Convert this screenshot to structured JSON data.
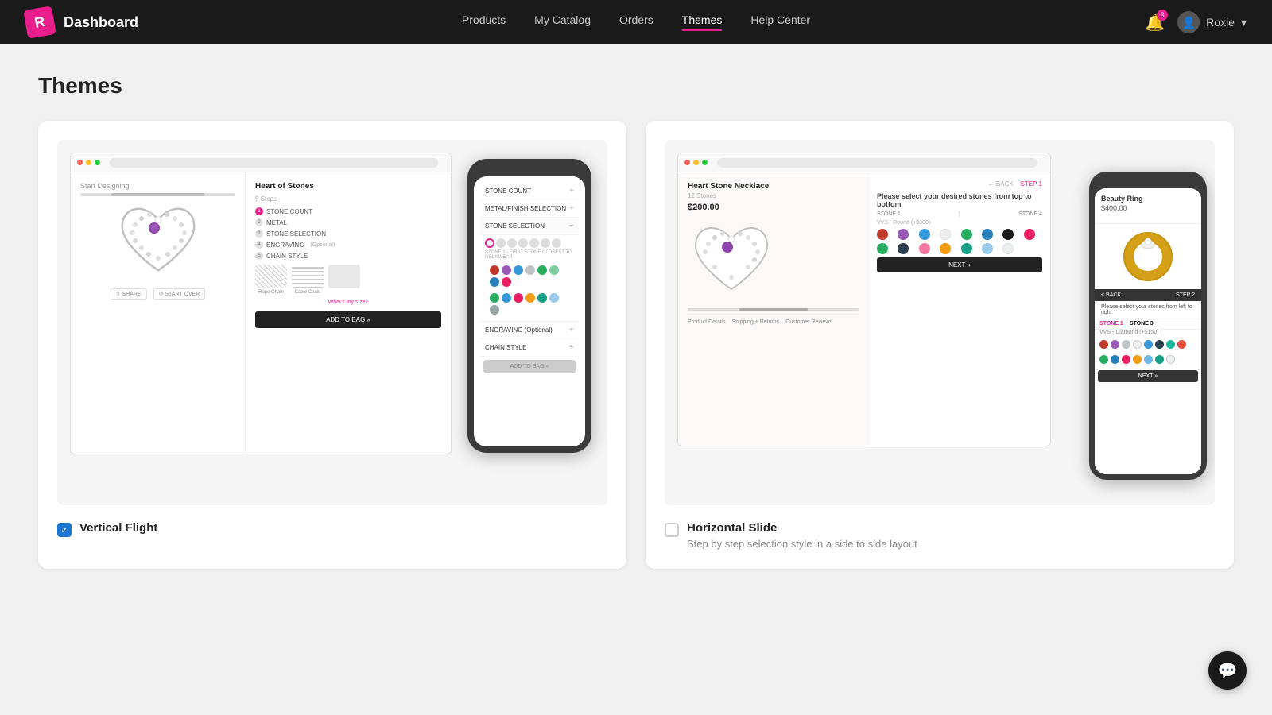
{
  "brand": {
    "logo_text": "R",
    "name": "Dashboard"
  },
  "nav": {
    "links": [
      {
        "label": "Products",
        "active": false
      },
      {
        "label": "My Catalog",
        "active": false
      },
      {
        "label": "Orders",
        "active": false
      },
      {
        "label": "Themes",
        "active": true
      },
      {
        "label": "Help Center",
        "active": false
      }
    ],
    "notification_count": "3",
    "user_name": "Roxie"
  },
  "page": {
    "title": "Themes"
  },
  "theme_left": {
    "product_title": "Heart of Stones",
    "steps": [
      {
        "num": "1",
        "label": "STONE COUNT",
        "active": true
      },
      {
        "num": "2",
        "label": "METAL",
        "active": false
      },
      {
        "num": "3",
        "label": "STONE SELECTION",
        "active": false
      },
      {
        "num": "4",
        "label": "ENGRAVING",
        "active": false
      },
      {
        "num": "5",
        "label": "CHAIN STYLE",
        "active": false
      }
    ],
    "chain_styles": [
      "Rope Chain",
      "Cable Chain"
    ],
    "add_to_bag": "ADD TO BAG »",
    "mobile": {
      "steps": [
        {
          "label": "STONE COUNT",
          "open": false
        },
        {
          "label": "METAL/FINISH SELECTION",
          "open": false
        },
        {
          "label": "STONE SELECTION",
          "open": true
        },
        {
          "label": "ENGRAVING (Optional)",
          "open": false
        },
        {
          "label": "CHAIN STYLE",
          "open": false
        }
      ],
      "add_to_bag": "ADD TO BAG »"
    },
    "checkbox_label": "Vertical Flight",
    "checked": true
  },
  "theme_right": {
    "product_title": "Heart Stone Necklace",
    "stone_count": "12 Stones",
    "price": "$200.00",
    "step_label": "STEP 1",
    "step_desc": "Please select your desired stones from top to bottom",
    "stone_nav": [
      "STONE 1",
      "STONE 4"
    ],
    "next_btn": "NEXT »",
    "detail_tabs": [
      "Product Details",
      "Shipping + Returns",
      "Customer Reviews"
    ],
    "mobile": {
      "title": "Beauty Ring",
      "price": "$400.00",
      "step_label": "STEP 2",
      "step_desc": "Please select your stones from left to right",
      "stone_labels": [
        "STONE 1",
        "STONE 3"
      ],
      "stone_price": "VVS - Diamond (+$150)",
      "next_btn": "NEXT »",
      "back_label": "< BACK"
    },
    "checkbox_label": "Horizontal Slide",
    "checked": false,
    "checkbox_desc": "Step by step selection style in a side to side layout"
  },
  "chat": {
    "icon": "💬"
  },
  "stones_colors_left": [
    "#c0392b",
    "#8e44ad",
    "#3498db",
    "#1abc9c",
    "#27ae60",
    "#e67e22",
    "#2980b9",
    "#e91e63",
    "#27ae60",
    "#2c3e50",
    "#f39c12",
    "#16a085",
    "#e74c3c",
    "#9b59b6",
    "#3498db"
  ],
  "stones_colors_right_top": [
    "#c0392b",
    "#8e44ad",
    "#3498db",
    "#ecf0f1",
    "#27ae60",
    "#2980b9",
    "#1a1a1a",
    "#e91e63"
  ],
  "stones_colors_right_bot": [
    "#27ae60",
    "#2c3e50",
    "#e91e63",
    "#f39c12",
    "#16a085",
    "#95a5a6",
    "#e74c3c"
  ],
  "stones_mobile_left": [
    "#c0392b",
    "#9b59b6",
    "#3498db",
    "#ecf0f1",
    "#27ae60",
    "#e91e63",
    "#e67e22",
    "#1abc9c",
    "#27ae60",
    "#3498db",
    "#f39c12",
    "#2980b9",
    "#95a5a6"
  ],
  "stones_mobile_right": [
    "#c0392b",
    "#9b59b6",
    "#bdc3c7",
    "#ecf0f1",
    "#3498db",
    "#2c3e50",
    "#1abc9c",
    "#e74c3c",
    "#27ae60",
    "#2980b9",
    "#e91e63",
    "#f39c12",
    "#3498db",
    "#16a085",
    "#95a5a6"
  ]
}
